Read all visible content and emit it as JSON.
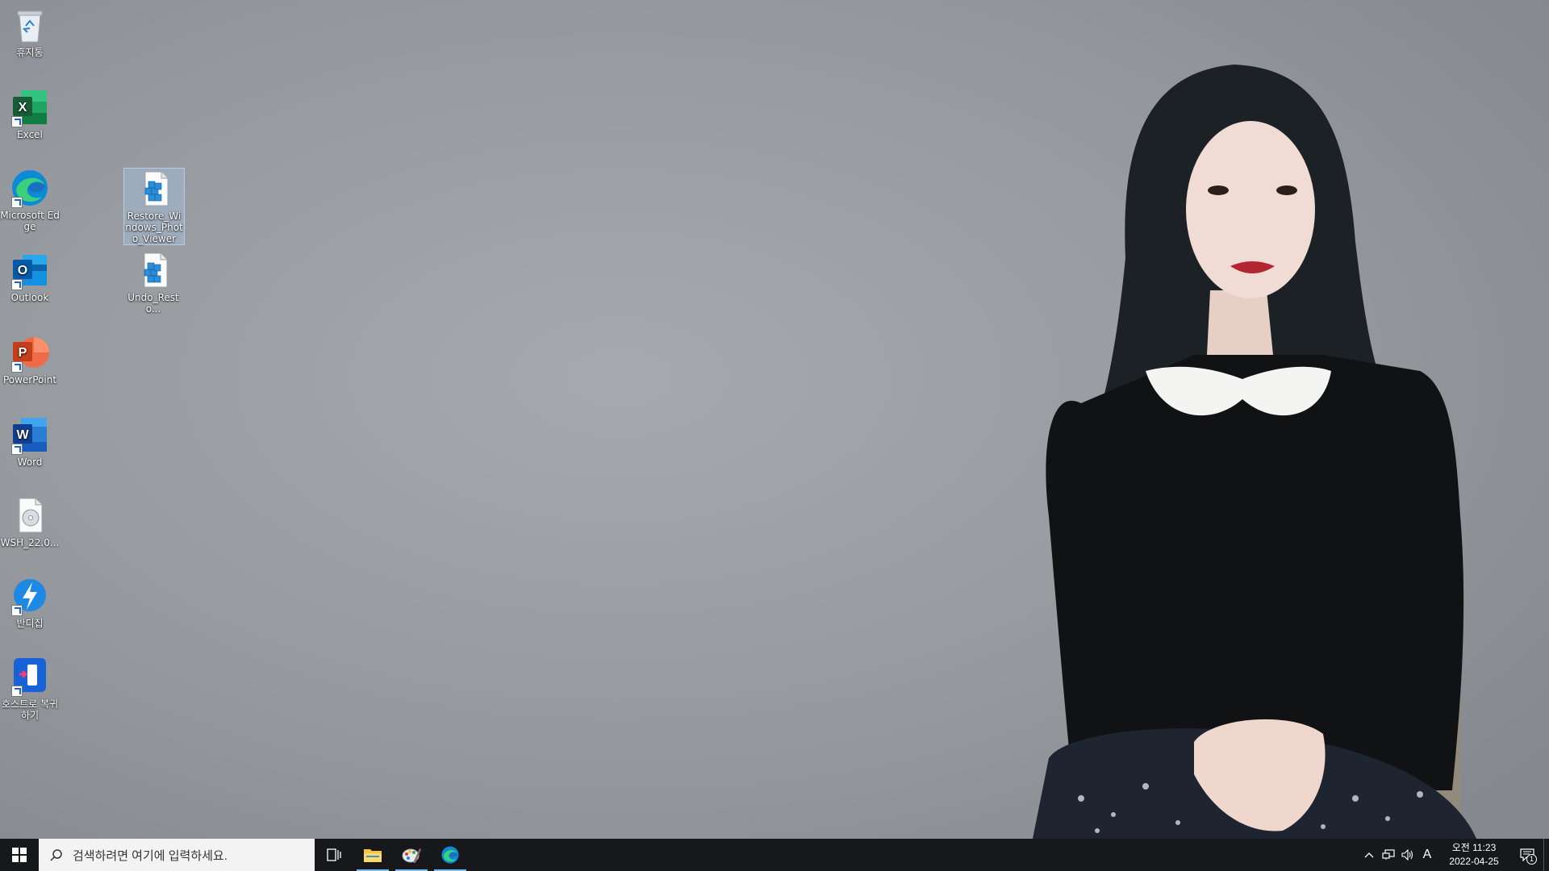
{
  "desktop": {
    "icons": [
      {
        "label": "휴지통",
        "icon": "recycle-bin-icon"
      },
      {
        "label": "Excel",
        "icon": "excel-icon"
      },
      {
        "label": "Microsoft Edge",
        "icon": "edge-icon"
      },
      {
        "label": "Outlook",
        "icon": "outlook-icon"
      },
      {
        "label": "PowerPoint",
        "icon": "powerpoint-icon"
      },
      {
        "label": "Word",
        "icon": "word-icon"
      },
      {
        "label": "WSH_22.0...",
        "icon": "disc-image-file-icon"
      },
      {
        "label": "반디집",
        "icon": "bandizip-icon"
      },
      {
        "label": "호스트로 복귀하기",
        "icon": "return-to-host-icon"
      },
      {
        "label": "Restore_Windows_Photo_Viewer",
        "icon": "registry-file-icon"
      },
      {
        "label": "Undo_Resto...",
        "icon": "registry-file-icon"
      }
    ]
  },
  "taskbar": {
    "search_placeholder": "검색하려면 여기에 입력하세요.",
    "pinned": [
      {
        "name": "task-view",
        "icon": "task-view-icon"
      },
      {
        "name": "file-explorer",
        "icon": "folder-icon"
      },
      {
        "name": "paint",
        "icon": "paint-icon"
      },
      {
        "name": "microsoft-edge",
        "icon": "edge-icon"
      }
    ],
    "tray": {
      "input_indicator": "A",
      "time": "오전 11:23",
      "date": "2022-04-25",
      "notification_count": "1"
    }
  },
  "colors": {
    "taskbar_bg": "#17181b",
    "search_bg": "#f3f3f3",
    "active_indicator": "#76b9ed"
  }
}
